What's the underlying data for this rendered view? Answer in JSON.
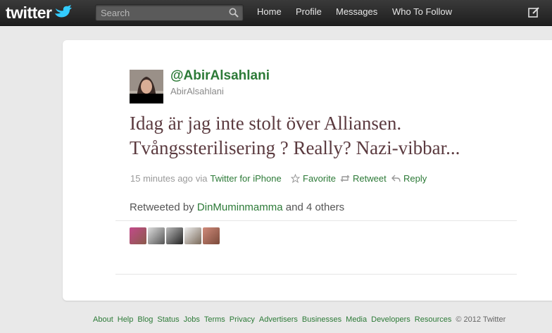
{
  "topbar": {
    "logo_text": "twitter",
    "search_placeholder": "Search",
    "nav": {
      "home": "Home",
      "profile": "Profile",
      "messages": "Messages",
      "who_to_follow": "Who To Follow"
    }
  },
  "tweet": {
    "screen_name": "@AbirAlsahlani",
    "user_name": "AbirAlsahlani",
    "text_line1": "Idag är jag inte stolt över Alliansen.",
    "text_line2": "Tvångssterilisering ? Really? Nazi-vibbar...",
    "timestamp": "15 minutes ago",
    "via": "via",
    "source": "Twitter for iPhone",
    "favorite_label": "Favorite",
    "retweet_label": "Retweet",
    "reply_label": "Reply",
    "retweeted_by_prefix": "Retweeted by",
    "retweeted_by_user": "DinMuminmamma",
    "retweeted_by_suffix": "and 4 others"
  },
  "colors": {
    "link": "#2c7a37",
    "tweet_text": "#5b3a3f",
    "topbar": "#262626",
    "background": "#e9e9e9"
  },
  "footer": {
    "links": [
      "About",
      "Help",
      "Blog",
      "Status",
      "Jobs",
      "Terms",
      "Privacy",
      "Advertisers",
      "Businesses",
      "Media",
      "Developers",
      "Resources"
    ],
    "copyright": "© 2012 Twitter"
  }
}
